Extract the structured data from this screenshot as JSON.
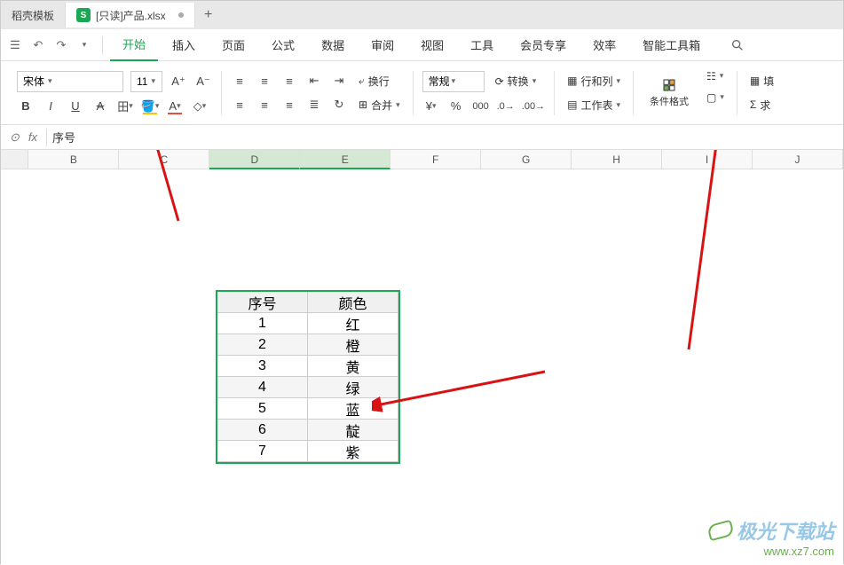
{
  "tabs": {
    "template_tab": "稻壳模板",
    "file_tab": "[只读]产品.xlsx",
    "add": "+"
  },
  "menu": {
    "undo": "↶",
    "redo": "↷",
    "items": [
      "开始",
      "插入",
      "页面",
      "公式",
      "数据",
      "审阅",
      "视图",
      "工具",
      "会员专享",
      "效率",
      "智能工具箱"
    ],
    "active_index": 0
  },
  "ribbon": {
    "font_name": "宋体",
    "font_size": "11",
    "bold": "B",
    "italic": "I",
    "underline": "U",
    "strike": "A",
    "border": "田",
    "wrap": "换行",
    "merge": "合并",
    "format_general": "常规",
    "convert": "转换",
    "rows_cols": "行和列",
    "worksheet": "工作表",
    "cond_format": "条件格式",
    "fill": "填",
    "sum": "求"
  },
  "formula_bar": {
    "fx": "fx",
    "value": "序号"
  },
  "columns": [
    "B",
    "C",
    "D",
    "E",
    "F",
    "G",
    "H",
    "I",
    "J"
  ],
  "selected_cols": [
    "D",
    "E"
  ],
  "table": {
    "headers": [
      "序号",
      "颜色"
    ],
    "rows": [
      [
        "1",
        "红"
      ],
      [
        "2",
        "橙"
      ],
      [
        "3",
        "黄"
      ],
      [
        "4",
        "绿"
      ],
      [
        "5",
        "蓝"
      ],
      [
        "6",
        "靛"
      ],
      [
        "7",
        "紫"
      ]
    ]
  },
  "watermark": {
    "title": "极光下载站",
    "url": "www.xz7.com"
  },
  "chart_data": {
    "type": "table",
    "title": "",
    "columns": [
      "序号",
      "颜色"
    ],
    "rows": [
      [
        1,
        "红"
      ],
      [
        2,
        "橙"
      ],
      [
        3,
        "黄"
      ],
      [
        4,
        "绿"
      ],
      [
        5,
        "蓝"
      ],
      [
        6,
        "靛"
      ],
      [
        7,
        "紫"
      ]
    ]
  }
}
